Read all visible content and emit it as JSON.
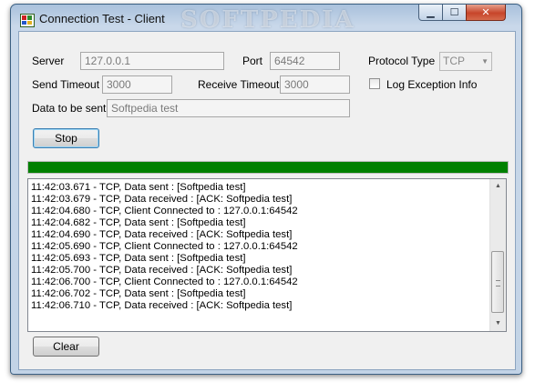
{
  "window": {
    "title": "Connection Test - Client",
    "watermark": "SOFTPEDIA",
    "controls": {
      "minimize": "▁",
      "maximize": "☐",
      "close": "✕"
    }
  },
  "form": {
    "server_label": "Server",
    "server_value": "127.0.0.1",
    "port_label": "Port",
    "port_value": "64542",
    "protocol_label": "Protocol Type",
    "protocol_value": "TCP",
    "send_timeout_label": "Send Timeout",
    "send_timeout_value": "3000",
    "receive_timeout_label": "Receive Timeout",
    "receive_timeout_value": "3000",
    "log_exception_label": "Log Exception Info",
    "log_exception_checked": false,
    "data_label": "Data to be sent",
    "data_value": "Softpedia test"
  },
  "buttons": {
    "stop": "Stop",
    "clear": "Clear"
  },
  "progress": {
    "value_percent": 100,
    "color": "#008000"
  },
  "log": {
    "lines": [
      "11:42:03.671 - TCP, Data sent : [Softpedia test]",
      "11:42:03.679 - TCP, Data received : [ACK: Softpedia test]",
      "11:42:04.680 - TCP, Client Connected to : 127.0.0.1:64542",
      "11:42:04.682 - TCP, Data sent : [Softpedia test]",
      "11:42:04.690 - TCP, Data received : [ACK: Softpedia test]",
      "11:42:05.690 - TCP, Client Connected to : 127.0.0.1:64542",
      "11:42:05.693 - TCP, Data sent : [Softpedia test]",
      "11:42:05.700 - TCP, Data received : [ACK: Softpedia test]",
      "11:42:06.700 - TCP, Client Connected to : 127.0.0.1:64542",
      "11:42:06.702 - TCP, Data sent : [Softpedia test]",
      "11:42:06.710 - TCP, Data received : [ACK: Softpedia test]"
    ]
  }
}
